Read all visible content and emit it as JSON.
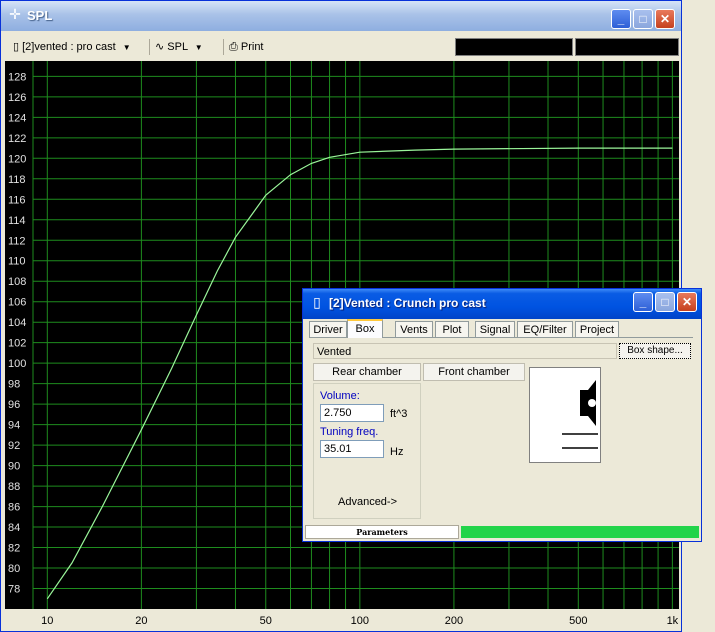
{
  "main_window": {
    "title": "SPL",
    "title_icon": "crosshair-icon",
    "toolbar": {
      "project_select": "[2]vented : pro cast",
      "view_select": "SPL",
      "print_label": "Print"
    },
    "plot": {
      "y_ticks": [
        "128",
        "126",
        "124",
        "122",
        "120",
        "118",
        "116",
        "114",
        "112",
        "110",
        "108",
        "106",
        "104",
        "102",
        "100",
        "98",
        "96",
        "94",
        "92",
        "90",
        "88",
        "86",
        "84",
        "82",
        "80",
        "78"
      ],
      "x_ticks": [
        "10",
        "20",
        "50",
        "100",
        "200",
        "500",
        "1k"
      ],
      "grid_color": "#1e8c1e",
      "curve_color": "#9af59a",
      "background": "#000000"
    }
  },
  "chart_data": {
    "type": "line",
    "xscale": "log",
    "xlim": [
      9,
      1050
    ],
    "ylim": [
      76,
      129.5
    ],
    "series": [
      {
        "x": [
          10,
          12,
          15,
          20,
          25,
          30,
          35,
          40,
          50,
          60,
          70,
          80,
          100,
          150,
          200,
          500,
          1000
        ],
        "y": [
          77,
          80.5,
          86,
          93.5,
          99.5,
          104.7,
          109,
          112.3,
          116.4,
          118.4,
          119.5,
          120.1,
          120.6,
          120.8,
          120.9,
          121.0,
          121.0
        ]
      }
    ]
  },
  "box_window": {
    "title": "[2]Vented : Crunch pro cast",
    "tabs": [
      "Driver",
      "Box",
      "Vents",
      "Plot",
      "Signal",
      "EQ/Filter",
      "Project"
    ],
    "active_tab": "Box",
    "box_type": "Vented",
    "box_shape_label": "Box shape...",
    "rear_chamber_label": "Rear chamber",
    "front_chamber_label": "Front chamber",
    "volume_label": "Volume:",
    "volume_value": "2.750",
    "volume_unit": "ft^3",
    "tuning_label": "Tuning freq.",
    "tuning_value": "35.01",
    "tuning_unit": "Hz",
    "advanced_label": "Advanced->",
    "status_label": "Parameters",
    "status_color": "#22d44a"
  }
}
